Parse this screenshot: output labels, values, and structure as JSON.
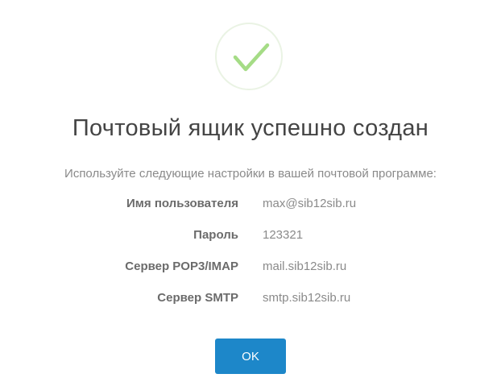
{
  "icon": "checkmark-success-icon",
  "colors": {
    "check": "#a5dc86",
    "circle_border": "#eaf3e4",
    "title": "#444444",
    "muted": "#8a8a8a",
    "label": "#6b6b6b",
    "button": "#1d87c9"
  },
  "title": "Почтовый ящик успешно создан",
  "subtitle": "Используйте следующие настройки в вашей почтовой программе:",
  "settings": [
    {
      "label": "Имя пользователя",
      "value": "max@sib12sib.ru"
    },
    {
      "label": "Пароль",
      "value": "123321"
    },
    {
      "label": "Сервер POP3/IMAP",
      "value": "mail.sib12sib.ru"
    },
    {
      "label": "Сервер SMTP",
      "value": "smtp.sib12sib.ru"
    }
  ],
  "ok_button": "OK"
}
